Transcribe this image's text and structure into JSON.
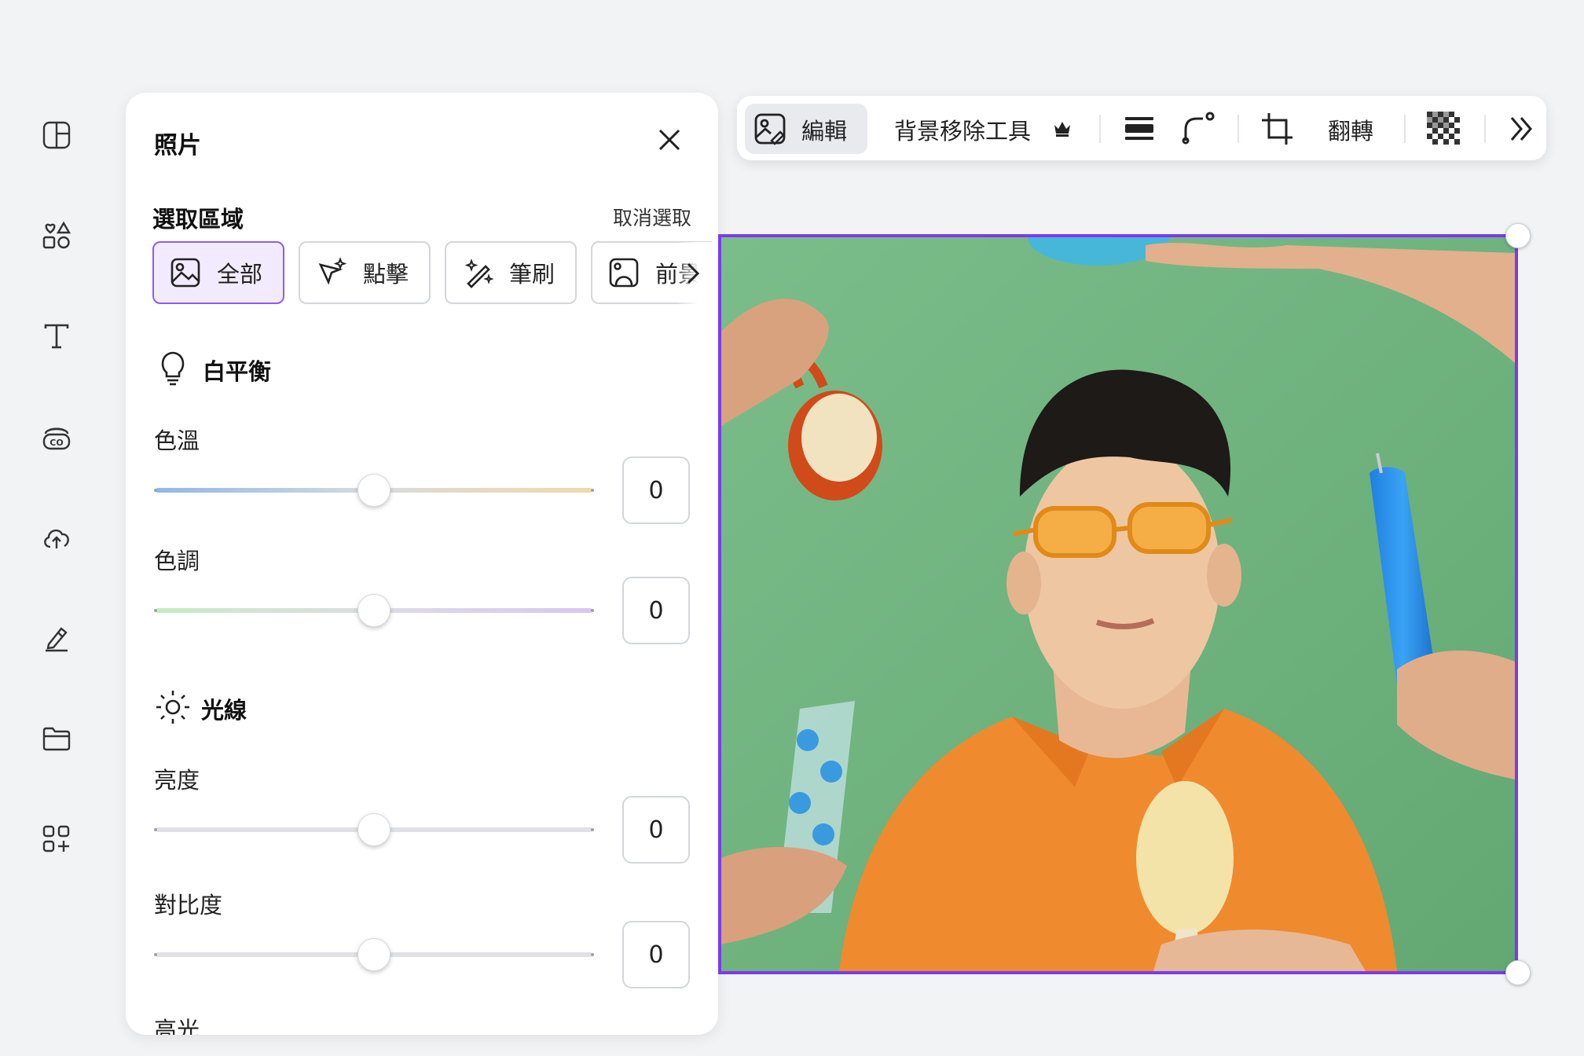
{
  "rail": {
    "items": [
      {
        "icon": "layout-icon"
      },
      {
        "icon": "elements-icon"
      },
      {
        "icon": "text-icon"
      },
      {
        "icon": "brand-icon"
      },
      {
        "icon": "upload-cloud-icon"
      },
      {
        "icon": "draw-icon"
      },
      {
        "icon": "folder-icon"
      },
      {
        "icon": "apps-icon"
      }
    ]
  },
  "panel": {
    "title": "照片",
    "selection": {
      "heading": "選取區域",
      "deselect_label": "取消選取",
      "options": [
        {
          "label": "全部",
          "icon": "image-icon",
          "active": true
        },
        {
          "label": "點擊",
          "icon": "sparkle-cursor-icon",
          "active": false
        },
        {
          "label": "筆刷",
          "icon": "magic-brush-icon",
          "active": false
        },
        {
          "label": "前景",
          "icon": "foreground-icon",
          "active": false
        }
      ]
    },
    "white_balance": {
      "heading": "白平衡",
      "temperature": {
        "label": "色溫",
        "value": "0"
      },
      "tint": {
        "label": "色調",
        "value": "0"
      }
    },
    "light": {
      "heading": "光線",
      "brightness": {
        "label": "亮度",
        "value": "0"
      },
      "contrast": {
        "label": "對比度",
        "value": "0"
      },
      "highlights": {
        "label": "高光"
      }
    }
  },
  "toolbar": {
    "edit_label": "編輯",
    "bg_remover_label": "背景移除工具",
    "flip_label": "翻轉",
    "icons": [
      "edit-image-icon",
      "crown-icon",
      "position-icon",
      "corner-radius-icon",
      "crop-icon",
      "transparency-icon",
      "more-chevrons-icon"
    ]
  },
  "colors": {
    "accent": "#7c3aed",
    "active_bg": "#f2ebff",
    "photo_bg": "#75b784"
  }
}
